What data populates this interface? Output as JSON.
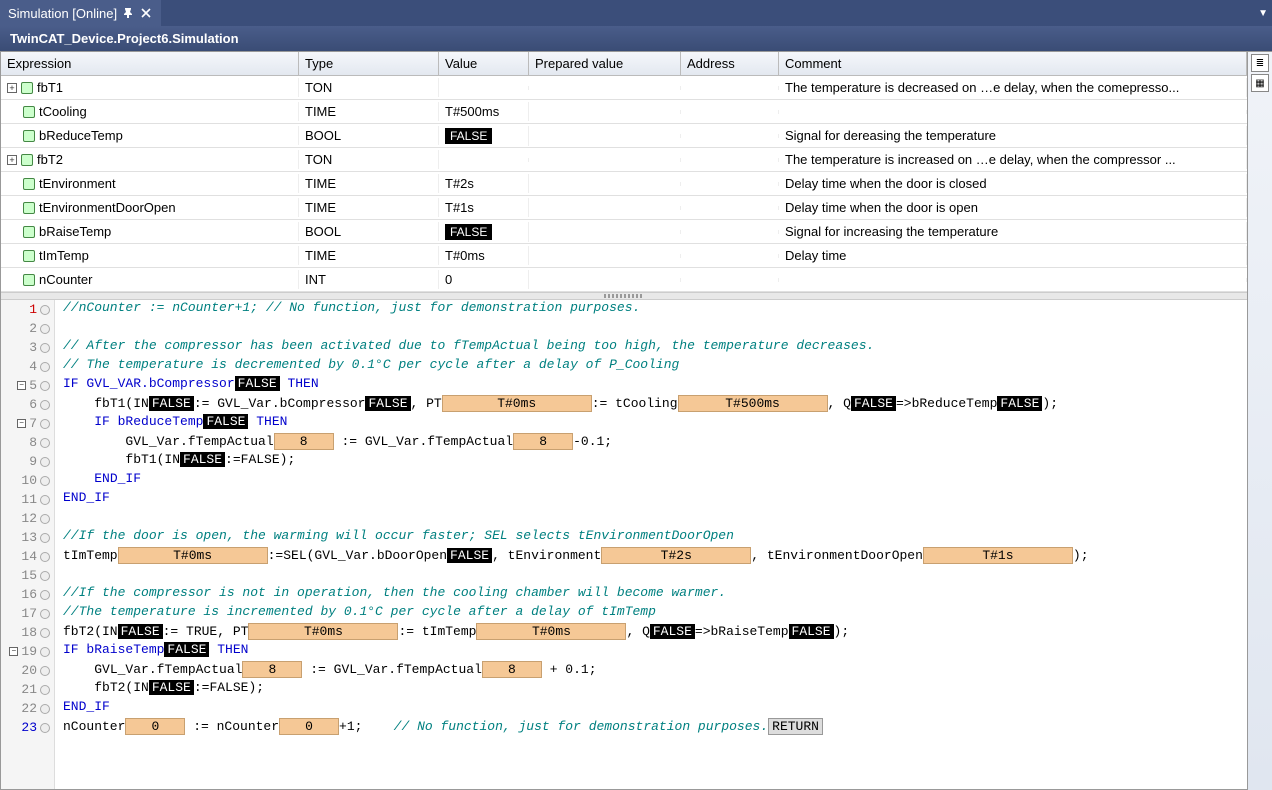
{
  "tab": {
    "title": "Simulation [Online]"
  },
  "title": "TwinCAT_Device.Project6.Simulation",
  "columns": {
    "expression": "Expression",
    "type": "Type",
    "value": "Value",
    "prepared": "Prepared value",
    "address": "Address",
    "comment": "Comment"
  },
  "vars": [
    {
      "expand": true,
      "name": "fbT1",
      "type": "TON",
      "value": "",
      "comment": "The temperature is decreased on …e delay, when the comepresso..."
    },
    {
      "expand": false,
      "name": "tCooling",
      "type": "TIME",
      "value": "T#500ms",
      "comment": ""
    },
    {
      "expand": false,
      "name": "bReduceTemp",
      "type": "BOOL",
      "value": "FALSE",
      "boolbox": true,
      "comment": "Signal for dereasing the temperature"
    },
    {
      "expand": true,
      "name": "fbT2",
      "type": "TON",
      "value": "",
      "comment": "The temperature is increased on …e delay, when the compressor ..."
    },
    {
      "expand": false,
      "name": "tEnvironment",
      "type": "TIME",
      "value": "T#2s",
      "comment": "Delay time when the door is closed"
    },
    {
      "expand": false,
      "name": "tEnvironmentDoorOpen",
      "type": "TIME",
      "value": "T#1s",
      "comment": "Delay time when the door is open"
    },
    {
      "expand": false,
      "name": "bRaiseTemp",
      "type": "BOOL",
      "value": "FALSE",
      "boolbox": true,
      "comment": "Signal for increasing the temperature"
    },
    {
      "expand": false,
      "name": "tImTemp",
      "type": "TIME",
      "value": "T#0ms",
      "comment": "Delay time"
    },
    {
      "expand": false,
      "name": "nCounter",
      "type": "INT",
      "value": "0",
      "comment": ""
    }
  ],
  "code": {
    "l1": "//nCounter := nCounter+1;    // No function, just for demonstration purposes.",
    "l3": "// After the compressor has been activated due to fTempActual being too high, the temperature decreases.",
    "l4": "// The temperature is decremented by 0.1°C per cycle after a delay of P_Cooling",
    "l5_pre": "IF GVL_VAR.bCompressor",
    "l5_false": "FALSE",
    "l5_post": " THEN",
    "l6_a": "fbT1(IN",
    "l6_false1": "FALSE",
    "l6_b": ":= GVL_Var.bCompressor",
    "l6_false2": "FALSE",
    "l6_c": ", PT",
    "l6_pt": "T#0ms",
    "l6_d": ":= tCooling",
    "l6_tc": "T#500ms",
    "l6_e": ", Q",
    "l6_false3": "FALSE",
    "l6_f": "=>bReduceTemp",
    "l6_false4": "FALSE",
    "l6_g": ");",
    "l7_a": "IF bReduceTemp",
    "l7_false": "FALSE",
    "l7_b": " THEN",
    "l8_a": "GVL_Var.fTempActual",
    "l8_v1": "8",
    "l8_b": " := GVL_Var.fTempActual",
    "l8_v2": "8",
    "l8_c": "-0.1;",
    "l9_a": "fbT1(IN",
    "l9_false": "FALSE",
    "l9_b": ":=FALSE);",
    "l10": "END_IF",
    "l11": "END_IF",
    "l13": "//If the door is open, the warming will occur faster; SEL selects tEnvironmentDoorOpen",
    "l14_a": "tImTemp",
    "l14_v1": "T#0ms",
    "l14_b": ":=SEL(GVL_Var.bDoorOpen",
    "l14_false": "FALSE",
    "l14_c": ", tEnvironment",
    "l14_v2": "T#2s",
    "l14_d": ", tEnvironmentDoorOpen",
    "l14_v3": "T#1s",
    "l14_e": ");",
    "l16": "//If the compressor is not in operation, then the cooling chamber will become warmer.",
    "l17": "//The  temperature is incremented by 0.1°C per cycle after a delay of tImTemp",
    "l18_a": "fbT2(IN",
    "l18_false1": "FALSE",
    "l18_b": ":= TRUE, PT",
    "l18_v1": "T#0ms",
    "l18_c": ":= tImTemp",
    "l18_v2": "T#0ms",
    "l18_d": ", Q",
    "l18_false2": "FALSE",
    "l18_e": "=>bRaiseTemp",
    "l18_false3": "FALSE",
    "l18_f": ");",
    "l19_a": "IF bRaiseTemp",
    "l19_false": "FALSE",
    "l19_b": " THEN",
    "l20_a": "GVL_Var.fTempActual",
    "l20_v1": "8",
    "l20_b": " := GVL_Var.fTempActual",
    "l20_v2": "8",
    "l20_c": " + 0.1;",
    "l21_a": "fbT2(IN",
    "l21_false": "FALSE",
    "l21_b": ":=FALSE);",
    "l22": "END_IF",
    "l23_a": "nCounter",
    "l23_v1": "0",
    "l23_b": " := nCounter",
    "l23_v2": "0",
    "l23_c": "+1;",
    "l23_cmt": "// No function, just for demonstration purposes.",
    "l23_ret": "RETURN"
  }
}
